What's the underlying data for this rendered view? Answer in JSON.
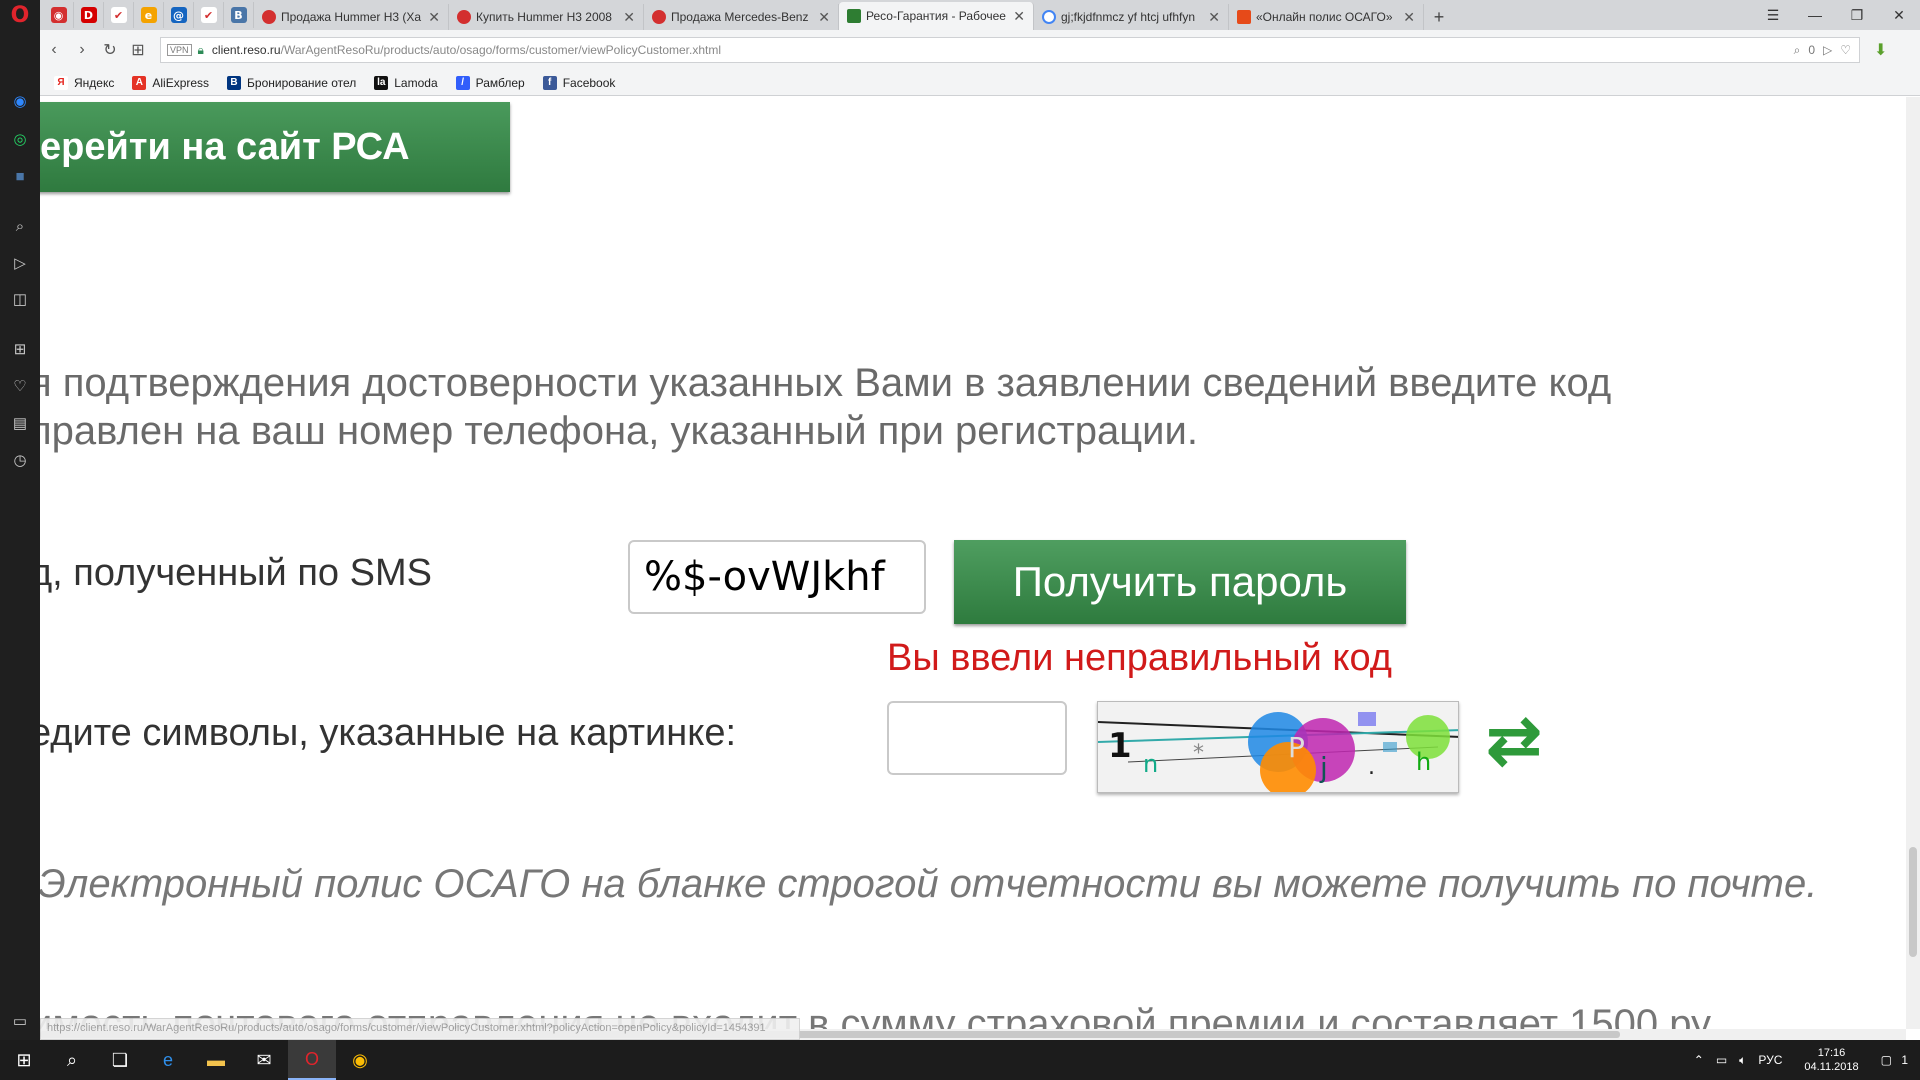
{
  "tabs": [
    {
      "title": "Продажа Hummer H3 (Ха",
      "color": "#d32f2f",
      "active": false
    },
    {
      "title": "Купить Hummer H3 2008",
      "color": "#d32f2f",
      "active": false
    },
    {
      "title": "Продажа Mercedes-Benz",
      "color": "#d32f2f",
      "active": false
    },
    {
      "title": "Ресо-Гарантия - Рабочее",
      "color": "#2e7d32",
      "active": true
    },
    {
      "title": "gj;fkjdfnmcz yf htcj ufhfyn",
      "color": "#4285f4",
      "active": false
    },
    {
      "title": "«Онлайн полис ОСАГО»",
      "color": "#e64a19",
      "active": false
    }
  ],
  "address": {
    "vpn": "VPN",
    "host": "client.reso.ru",
    "path": "/WarAgentResoRu/products/auto/osago/forms/customer/viewPolicyCustomer.xhtml",
    "badge": "0"
  },
  "bookmarks": [
    {
      "label": "Яндекс",
      "icon": "Я",
      "color": "#e52620"
    },
    {
      "label": "AliExpress",
      "icon": "A",
      "color": "#e43225"
    },
    {
      "label": "Бронирование отел",
      "icon": "B",
      "color": "#003580"
    },
    {
      "label": "Lamoda",
      "icon": "la",
      "color": "#111111"
    },
    {
      "label": "Рамблер",
      "icon": "/",
      "color": "#315efb"
    },
    {
      "label": "Facebook",
      "icon": "f",
      "color": "#3b5998"
    }
  ],
  "page": {
    "rsa_button": "ерейти на сайт РСА",
    "info_line1": "я подтверждения достоверности указанных Вами в заявлении сведений введите код",
    "info_line2": "правлен на ваш номер телефона, указанный при регистрации.",
    "sms_label": "д, полученный по SMS",
    "sms_value": "%$-ovWJkhf",
    "get_password": "Получить пароль",
    "error": "Вы ввели неправильный код",
    "captcha_label": "едите символы, указанные на картинке:",
    "captcha_value": "",
    "epolicy": "Электронный полис ОСАГО на бланке строгой отчетности вы можете получить по почте.",
    "cost": "имость почтового отправления не входит в сумму страховой премии и составляет 1500 ру"
  },
  "status_url": "https://client.reso.ru/WarAgentResoRu/products/auto/osago/forms/customer/viewPolicyCustomer.xhtml?policyAction=openPolicy&policyId=1454391",
  "taskbar": {
    "lang": "РУС",
    "time": "17:16",
    "date": "04.11.2018",
    "notifications": "1"
  },
  "colors": {
    "accent_green": "#2e7b3e",
    "error_red": "#d11a1a"
  }
}
